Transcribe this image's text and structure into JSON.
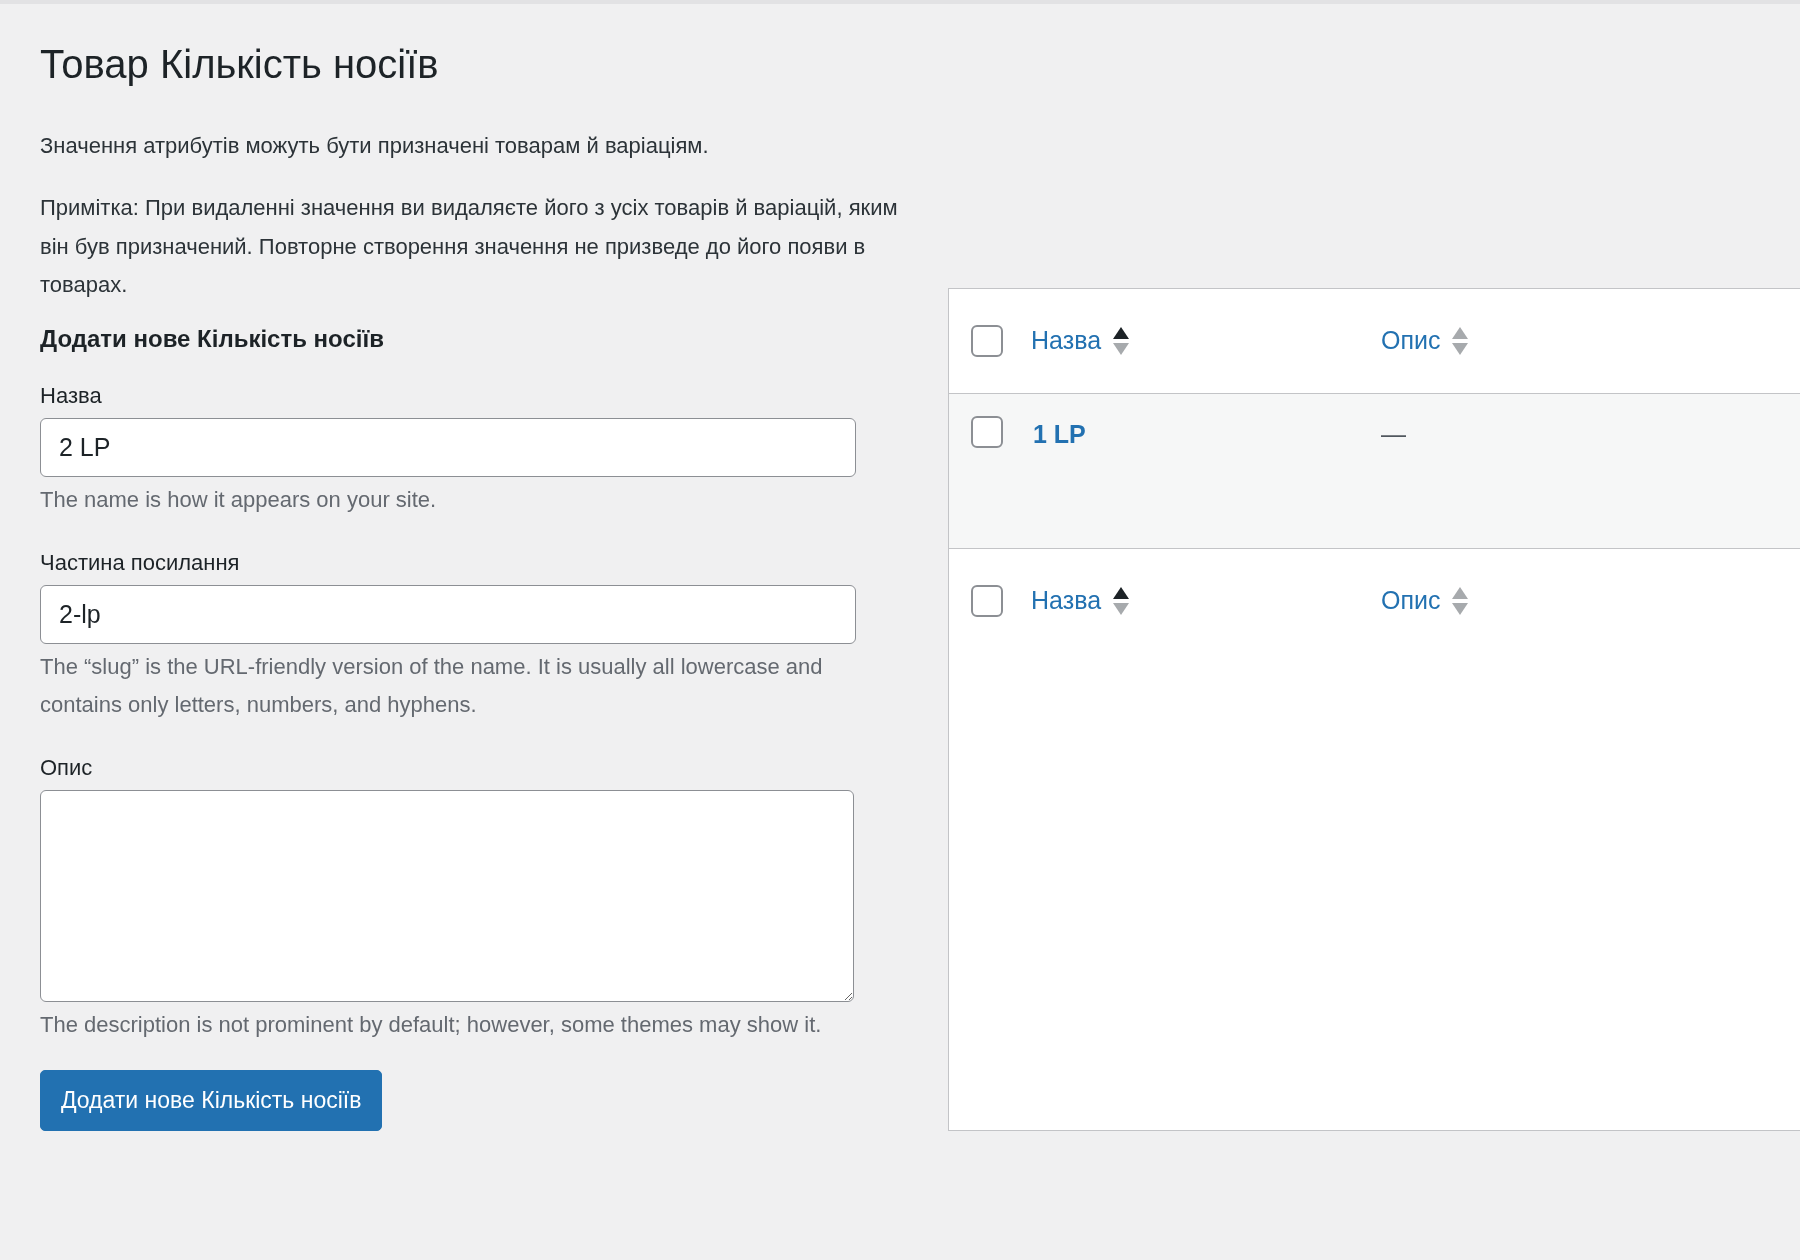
{
  "page": {
    "title": "Товар Кількість носіїв",
    "intro": "Значення атрибутів можуть бути призначені товарам й варіаціям.",
    "note": "Примітка: При видаленні значення ви видаляєте його з усіх товарів й варіацій, яким він був призначений. Повторне створення значення не призведе до його появи в товарах."
  },
  "form": {
    "heading": "Додати нове Кількість носіїв",
    "fields": [
      {
        "kind": "input",
        "label": "Назва",
        "value": "2 LP",
        "help": "The name is how it appears on your site."
      },
      {
        "kind": "input",
        "label": "Частина посилання",
        "value": "2-lp",
        "help": "The “slug” is the URL-friendly version of the name. It is usually all lowercase and contains only letters, numbers, and hyphens."
      },
      {
        "kind": "textarea",
        "label": "Опис",
        "help": "The description is not prominent by default; however, some themes may show it."
      }
    ],
    "submit": "Додати нове Кількість носіїв"
  },
  "table": {
    "header": {
      "checked": false,
      "columns": [
        {
          "label": "Назва",
          "sorted": true
        },
        {
          "label": "Опис",
          "sorted": false
        }
      ]
    },
    "rows": [
      {
        "checked": false,
        "name": "1 LP",
        "description": "—"
      }
    ],
    "footer": {
      "checked": false,
      "columns": [
        {
          "label": "Назва",
          "sorted": true
        },
        {
          "label": "Опис",
          "sorted": false
        }
      ]
    }
  }
}
